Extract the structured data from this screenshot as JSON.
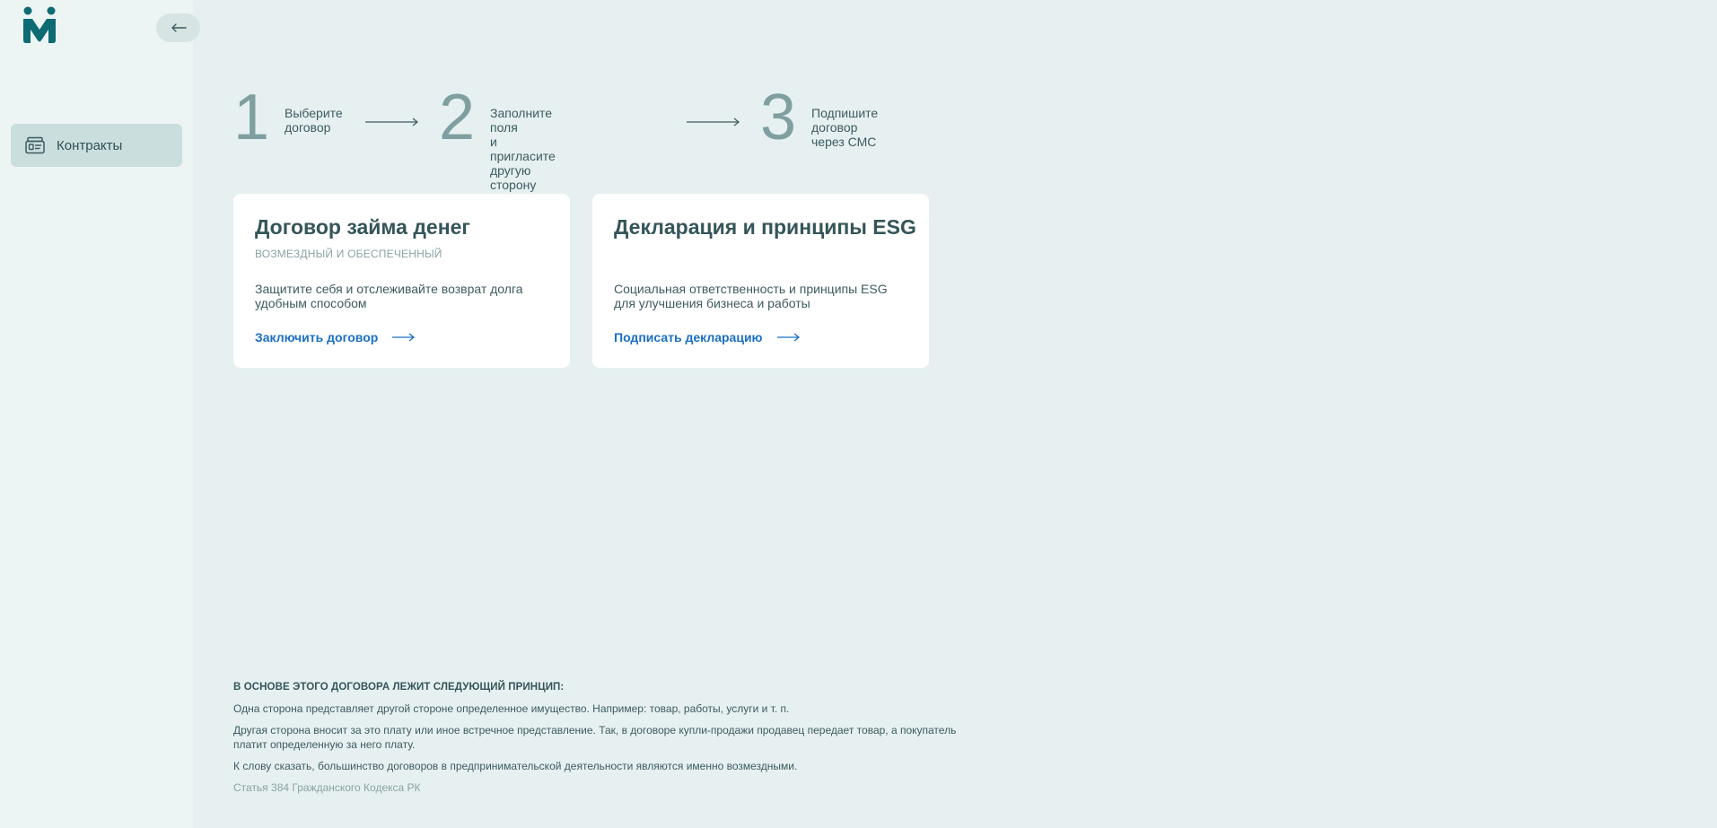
{
  "brand": {
    "logo_icon": "people-logo-icon",
    "accent_color": "#0f6b73"
  },
  "sidebar": {
    "collapse_icon": "arrow-left-icon",
    "items": [
      {
        "label": "Контракты",
        "icon": "contracts-icon",
        "active": true
      }
    ]
  },
  "steps": [
    {
      "number": "1",
      "text": "Выберите\nдоговор"
    },
    {
      "number": "2",
      "text": "Заполните поля\nи пригласите другую сторону"
    },
    {
      "number": "3",
      "text": "Подпишите договор\nчерез СМС"
    }
  ],
  "cards": [
    {
      "title": "Договор займа денег",
      "subtitle": "ВОЗМЕЗДНЫЙ И ОБЕСПЕЧЕННЫЙ",
      "description": "Защитите себя и отслеживайте возврат долга удобным способом",
      "link_label": "Заключить договор"
    },
    {
      "title": "Декларация и принципы ESG",
      "subtitle": "",
      "description": "Социальная ответственность и принципы ESG для улучшения бизнеса и работы",
      "link_label": "Подписать декларацию"
    }
  ],
  "info": {
    "heading": "В ОСНОВЕ ЭТОГО ДОГОВОРА ЛЕЖИТ СЛЕДУЮЩИЙ ПРИНЦИП:",
    "paragraphs": [
      "Одна сторона представляет другой стороне определенное имущество. Например: товар, работы, услуги и т. п.",
      "Другая сторона вносит за это плату или иное встречное представление. Так, в договоре купли-продажи продавец передает товар, а покупатель платит определенную за него плату.",
      "К слову сказать, большинство договоров в предпринимательской деятельности являются именно возмездными."
    ],
    "source": "Статья 384 Гражданского Кодекса РК"
  }
}
